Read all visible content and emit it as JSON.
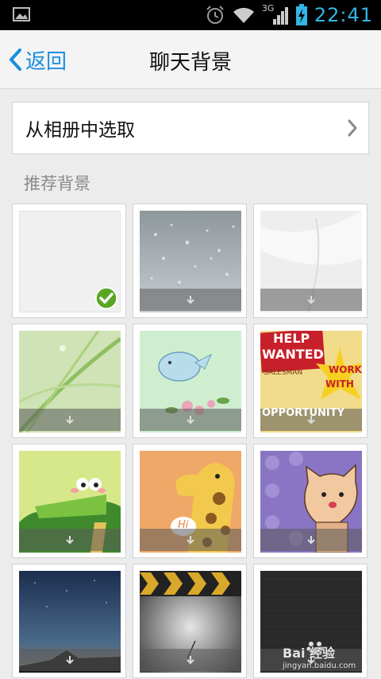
{
  "status_bar": {
    "time": "22:41",
    "network": "3G"
  },
  "header": {
    "back_label": "返回",
    "title": "聊天背景"
  },
  "album": {
    "label": "从相册中选取"
  },
  "section": {
    "label": "推荐背景"
  },
  "backgrounds": [
    {
      "theme": "plain-white",
      "selected": true
    },
    {
      "theme": "rain-drops-glass",
      "selected": false
    },
    {
      "theme": "white-feather",
      "selected": false
    },
    {
      "theme": "green-grass-dew",
      "selected": false
    },
    {
      "theme": "blue-bird-flowers",
      "selected": false
    },
    {
      "theme": "help-wanted-poster",
      "selected": false
    },
    {
      "theme": "green-crocodile",
      "selected": false
    },
    {
      "theme": "yellow-giraffe-hi",
      "selected": false
    },
    {
      "theme": "pink-cat-purple",
      "selected": false
    },
    {
      "theme": "night-starry-sky",
      "selected": false
    },
    {
      "theme": "chevron-metal",
      "selected": false
    },
    {
      "theme": "dark-carbon",
      "selected": false
    }
  ],
  "poster": {
    "line1": "HELP",
    "line2": "WANTED",
    "line3": "SALESMAN",
    "line4": "WORK",
    "line5": "WITH",
    "line6": "OPPORTUNITY"
  },
  "giraffe": {
    "bubble": "Hi"
  },
  "watermark": {
    "text": "Bai 经验",
    "url_text": "jingyan.baidu.com"
  }
}
